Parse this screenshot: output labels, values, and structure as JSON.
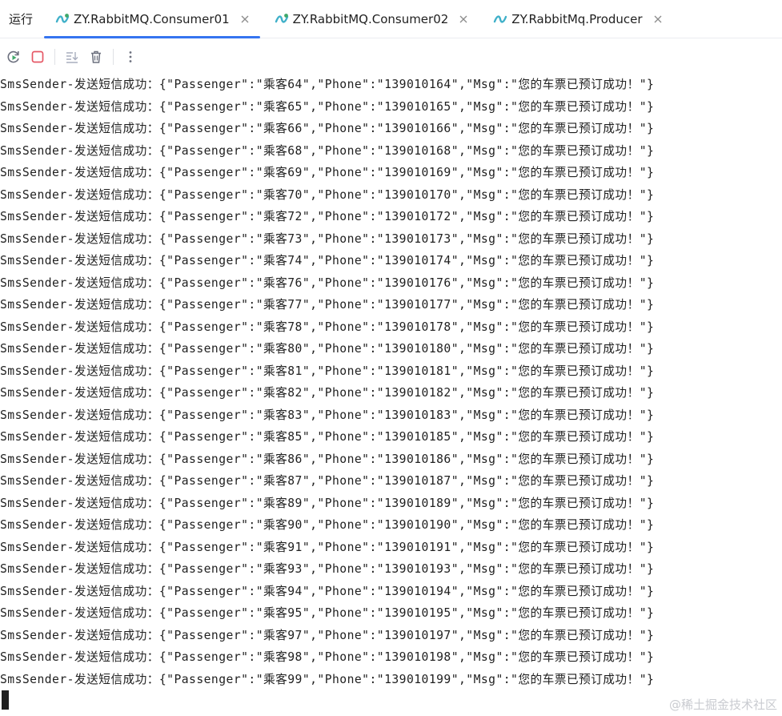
{
  "panel": {
    "title": "运行"
  },
  "tabs": [
    {
      "label": "ZY.RabbitMQ.Consumer01",
      "active": true,
      "icon": "run-config-icon"
    },
    {
      "label": "ZY.RabbitMQ.Consumer02",
      "active": false,
      "icon": "run-config-icon"
    },
    {
      "label": "ZY.RabbitMq.Producer",
      "active": false,
      "icon": "run-config-icon"
    }
  ],
  "toolbar": {
    "buttons": [
      "rerun-icon",
      "stop-icon",
      "scroll-to-end-icon",
      "clear-all-icon",
      "more-options-icon"
    ]
  },
  "console": {
    "lines": [
      "SmsSender-发送短信成功：{\"Passenger\":\"乘客64\",\"Phone\":\"139010164\",\"Msg\":\"您的车票已预订成功！\"}",
      "SmsSender-发送短信成功：{\"Passenger\":\"乘客65\",\"Phone\":\"139010165\",\"Msg\":\"您的车票已预订成功！\"}",
      "SmsSender-发送短信成功：{\"Passenger\":\"乘客66\",\"Phone\":\"139010166\",\"Msg\":\"您的车票已预订成功！\"}",
      "SmsSender-发送短信成功：{\"Passenger\":\"乘客68\",\"Phone\":\"139010168\",\"Msg\":\"您的车票已预订成功！\"}",
      "SmsSender-发送短信成功：{\"Passenger\":\"乘客69\",\"Phone\":\"139010169\",\"Msg\":\"您的车票已预订成功！\"}",
      "SmsSender-发送短信成功：{\"Passenger\":\"乘客70\",\"Phone\":\"139010170\",\"Msg\":\"您的车票已预订成功！\"}",
      "SmsSender-发送短信成功：{\"Passenger\":\"乘客72\",\"Phone\":\"139010172\",\"Msg\":\"您的车票已预订成功！\"}",
      "SmsSender-发送短信成功：{\"Passenger\":\"乘客73\",\"Phone\":\"139010173\",\"Msg\":\"您的车票已预订成功！\"}",
      "SmsSender-发送短信成功：{\"Passenger\":\"乘客74\",\"Phone\":\"139010174\",\"Msg\":\"您的车票已预订成功！\"}",
      "SmsSender-发送短信成功：{\"Passenger\":\"乘客76\",\"Phone\":\"139010176\",\"Msg\":\"您的车票已预订成功！\"}",
      "SmsSender-发送短信成功：{\"Passenger\":\"乘客77\",\"Phone\":\"139010177\",\"Msg\":\"您的车票已预订成功！\"}",
      "SmsSender-发送短信成功：{\"Passenger\":\"乘客78\",\"Phone\":\"139010178\",\"Msg\":\"您的车票已预订成功！\"}",
      "SmsSender-发送短信成功：{\"Passenger\":\"乘客80\",\"Phone\":\"139010180\",\"Msg\":\"您的车票已预订成功！\"}",
      "SmsSender-发送短信成功：{\"Passenger\":\"乘客81\",\"Phone\":\"139010181\",\"Msg\":\"您的车票已预订成功！\"}",
      "SmsSender-发送短信成功：{\"Passenger\":\"乘客82\",\"Phone\":\"139010182\",\"Msg\":\"您的车票已预订成功！\"}",
      "SmsSender-发送短信成功：{\"Passenger\":\"乘客83\",\"Phone\":\"139010183\",\"Msg\":\"您的车票已预订成功！\"}",
      "SmsSender-发送短信成功：{\"Passenger\":\"乘客85\",\"Phone\":\"139010185\",\"Msg\":\"您的车票已预订成功！\"}",
      "SmsSender-发送短信成功：{\"Passenger\":\"乘客86\",\"Phone\":\"139010186\",\"Msg\":\"您的车票已预订成功！\"}",
      "SmsSender-发送短信成功：{\"Passenger\":\"乘客87\",\"Phone\":\"139010187\",\"Msg\":\"您的车票已预订成功！\"}",
      "SmsSender-发送短信成功：{\"Passenger\":\"乘客89\",\"Phone\":\"139010189\",\"Msg\":\"您的车票已预订成功！\"}",
      "SmsSender-发送短信成功：{\"Passenger\":\"乘客90\",\"Phone\":\"139010190\",\"Msg\":\"您的车票已预订成功！\"}",
      "SmsSender-发送短信成功：{\"Passenger\":\"乘客91\",\"Phone\":\"139010191\",\"Msg\":\"您的车票已预订成功！\"}",
      "SmsSender-发送短信成功：{\"Passenger\":\"乘客93\",\"Phone\":\"139010193\",\"Msg\":\"您的车票已预订成功！\"}",
      "SmsSender-发送短信成功：{\"Passenger\":\"乘客94\",\"Phone\":\"139010194\",\"Msg\":\"您的车票已预订成功！\"}",
      "SmsSender-发送短信成功：{\"Passenger\":\"乘客95\",\"Phone\":\"139010195\",\"Msg\":\"您的车票已预订成功！\"}",
      "SmsSender-发送短信成功：{\"Passenger\":\"乘客97\",\"Phone\":\"139010197\",\"Msg\":\"您的车票已预订成功！\"}",
      "SmsSender-发送短信成功：{\"Passenger\":\"乘客98\",\"Phone\":\"139010198\",\"Msg\":\"您的车票已预订成功！\"}",
      "SmsSender-发送短信成功：{\"Passenger\":\"乘客99\",\"Phone\":\"139010199\",\"Msg\":\"您的车票已预订成功！\"}"
    ]
  },
  "watermark": "@稀土掘金技术社区",
  "colors": {
    "accent": "#3574f0",
    "stop": "#e55765",
    "rerun": "#3fa86a"
  }
}
